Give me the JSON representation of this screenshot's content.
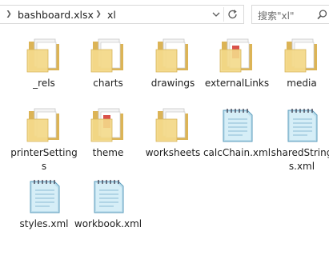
{
  "address_bar": {
    "segments": [
      "bashboard.xlsx",
      "xl"
    ]
  },
  "search": {
    "placeholder": "搜索\"xl\""
  },
  "items": [
    {
      "label": "_rels",
      "type": "folder",
      "content": "docs"
    },
    {
      "label": "charts",
      "type": "folder",
      "content": "docs"
    },
    {
      "label": "drawings",
      "type": "folder",
      "content": "docs"
    },
    {
      "label": "externalLinks",
      "type": "folder",
      "content": "red"
    },
    {
      "label": "media",
      "type": "folder",
      "content": "docs"
    },
    {
      "label": "printerSettings",
      "type": "folder",
      "content": "docs"
    },
    {
      "label": "theme",
      "type": "folder",
      "content": "red"
    },
    {
      "label": "worksheets",
      "type": "folder",
      "content": "docs"
    },
    {
      "label": "calcChain.xml",
      "type": "xml"
    },
    {
      "label": "sharedStrings.xml",
      "type": "xml"
    },
    {
      "label": "styles.xml",
      "type": "xml"
    },
    {
      "label": "workbook.xml",
      "type": "xml"
    }
  ],
  "icons": {
    "folder": "folder-icon",
    "xml": "xml-file-icon",
    "refresh": "refresh-icon",
    "search": "search-icon",
    "dropdown": "chevron-down-icon"
  }
}
